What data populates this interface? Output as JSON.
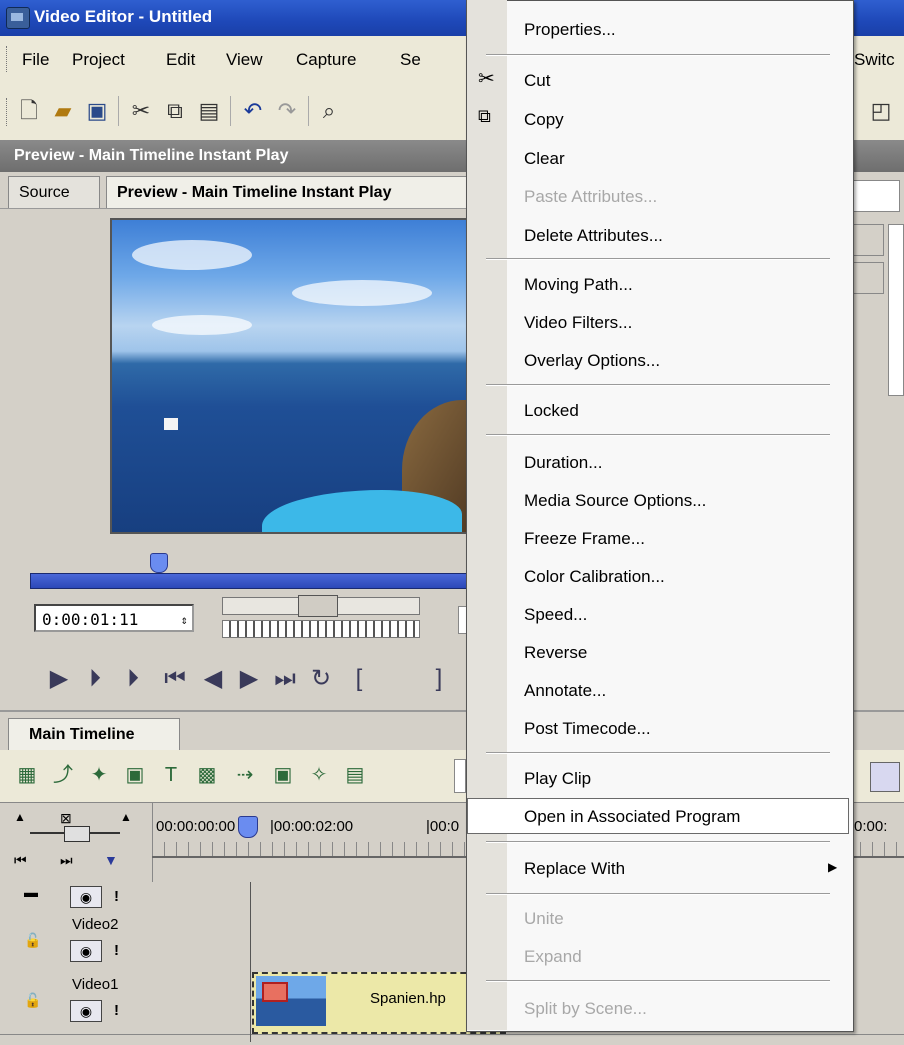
{
  "window": {
    "title": "Video Editor - Untitled"
  },
  "menubar": {
    "items": [
      "File",
      "Project",
      "Edit",
      "View",
      "Capture",
      "Se",
      "Switc"
    ]
  },
  "panel": {
    "header": "Preview - Main Timeline Instant Play"
  },
  "tabs": [
    "Source",
    "Preview - Main Timeline Instant Play"
  ],
  "player": {
    "timecode": "0:00:01:11"
  },
  "timeline": {
    "tab": "Main Timeline",
    "ruler": [
      "00:00:00:00",
      "|00:00:02:00",
      "|00:0",
      "0:00:"
    ],
    "tracks": [
      {
        "name": ""
      },
      {
        "name": "Video2"
      },
      {
        "name": "Video1"
      }
    ],
    "clip": {
      "name": "Spanien.hp"
    }
  },
  "context_menu": {
    "items": [
      {
        "label": "Properties...",
        "enabled": true
      },
      {
        "label": "Cut",
        "enabled": true,
        "icon": "scissors-icon"
      },
      {
        "label": "Copy",
        "enabled": true,
        "icon": "copy-icon"
      },
      {
        "label": "Clear",
        "enabled": true
      },
      {
        "label": "Paste Attributes...",
        "enabled": false
      },
      {
        "label": "Delete Attributes...",
        "enabled": true
      },
      {
        "label": "Moving Path...",
        "enabled": true
      },
      {
        "label": "Video Filters...",
        "enabled": true
      },
      {
        "label": "Overlay Options...",
        "enabled": true
      },
      {
        "label": "Locked",
        "enabled": true
      },
      {
        "label": "Duration...",
        "enabled": true
      },
      {
        "label": "Media Source Options...",
        "enabled": true
      },
      {
        "label": "Freeze Frame...",
        "enabled": true
      },
      {
        "label": "Color Calibration...",
        "enabled": true
      },
      {
        "label": "Speed...",
        "enabled": true
      },
      {
        "label": "Reverse",
        "enabled": true
      },
      {
        "label": "Annotate...",
        "enabled": true
      },
      {
        "label": "Post Timecode...",
        "enabled": true
      },
      {
        "label": "Play Clip",
        "enabled": true
      },
      {
        "label": "Open in Associated Program",
        "enabled": true,
        "highlighted": true
      },
      {
        "label": "Replace With",
        "enabled": true,
        "submenu": true
      },
      {
        "label": "Unite",
        "enabled": false
      },
      {
        "label": "Expand",
        "enabled": false
      },
      {
        "label": "Split by Scene...",
        "enabled": false
      }
    ]
  },
  "colors": {
    "titlebar": "#1e48b8",
    "scrub_bar": "#3a58c8",
    "highlight_border": "#6a6a6a"
  }
}
